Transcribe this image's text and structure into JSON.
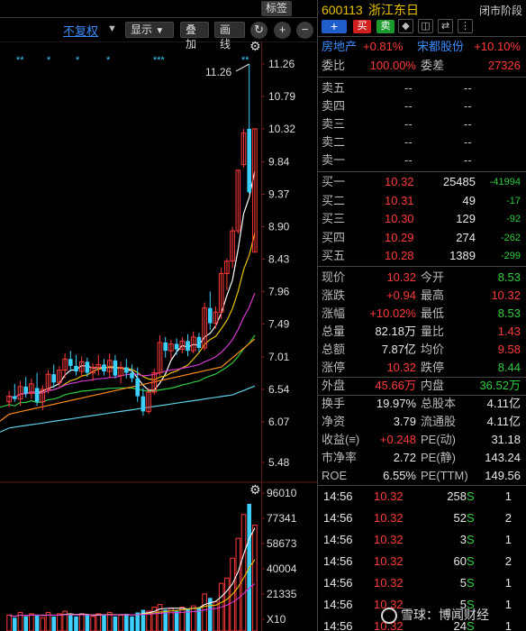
{
  "toolbar": {
    "label_button": "标签",
    "adjust_mode": "不复权",
    "display_label": "显示",
    "overlay_label": "叠加",
    "draw_label": "画线",
    "refresh_icon": "↻",
    "zoom_in_icon": "+",
    "zoom_out_icon": "−"
  },
  "chart_data": {
    "type": "candlestick",
    "main_axis_ticks": [
      "11.26",
      "10.79",
      "10.32",
      "9.84",
      "9.37",
      "8.90",
      "8.43",
      "7.96",
      "7.49",
      "7.01",
      "6.54",
      "6.07",
      "5.48"
    ],
    "ylim": [
      5.48,
      11.26
    ],
    "high_annotation": "11.26",
    "volume_axis_ticks": [
      "96010",
      "77341",
      "58673",
      "40004",
      "21335",
      "X10"
    ],
    "volume_ylim": [
      0,
      96010
    ],
    "markers": [
      "**",
      "*",
      "*",
      "*",
      "***",
      "**"
    ],
    "colors": {
      "up": "#ff3a3a",
      "up_hollow": "#ff3a3a",
      "down": "#3bd0ff",
      "ma5": "#ffffff",
      "ma10": "#e8c200",
      "ma20": "#d43ad4",
      "ma30": "#2ecc40",
      "ma60": "#ff8c1a",
      "ma120": "#5bd0e8"
    },
    "candles": [
      {
        "o": 6.36,
        "h": 6.52,
        "l": 6.28,
        "c": 6.44
      },
      {
        "o": 6.44,
        "h": 6.62,
        "l": 6.36,
        "c": 6.4
      },
      {
        "o": 6.4,
        "h": 6.66,
        "l": 6.3,
        "c": 6.58
      },
      {
        "o": 6.58,
        "h": 6.72,
        "l": 6.42,
        "c": 6.48
      },
      {
        "o": 6.48,
        "h": 6.7,
        "l": 6.4,
        "c": 6.62
      },
      {
        "o": 6.56,
        "h": 6.78,
        "l": 6.3,
        "c": 6.36
      },
      {
        "o": 6.36,
        "h": 6.6,
        "l": 6.24,
        "c": 6.54
      },
      {
        "o": 6.54,
        "h": 6.82,
        "l": 6.48,
        "c": 6.76
      },
      {
        "o": 6.76,
        "h": 6.9,
        "l": 6.56,
        "c": 6.64
      },
      {
        "o": 6.64,
        "h": 6.88,
        "l": 6.58,
        "c": 6.82
      },
      {
        "o": 6.82,
        "h": 7.06,
        "l": 6.7,
        "c": 6.98
      },
      {
        "o": 6.98,
        "h": 7.1,
        "l": 6.8,
        "c": 6.88
      },
      {
        "o": 6.88,
        "h": 7.04,
        "l": 6.74,
        "c": 6.8
      },
      {
        "o": 6.8,
        "h": 7.02,
        "l": 6.72,
        "c": 6.94
      },
      {
        "o": 6.94,
        "h": 7.0,
        "l": 6.72,
        "c": 6.78
      },
      {
        "o": 6.78,
        "h": 6.92,
        "l": 6.66,
        "c": 6.86
      },
      {
        "o": 6.86,
        "h": 7.04,
        "l": 6.74,
        "c": 6.9
      },
      {
        "o": 6.9,
        "h": 6.98,
        "l": 6.74,
        "c": 6.8
      },
      {
        "o": 6.8,
        "h": 7.06,
        "l": 6.7,
        "c": 6.96
      },
      {
        "o": 6.96,
        "h": 7.04,
        "l": 6.7,
        "c": 6.74
      },
      {
        "o": 6.74,
        "h": 6.94,
        "l": 6.62,
        "c": 6.86
      },
      {
        "o": 6.86,
        "h": 6.98,
        "l": 6.7,
        "c": 6.78
      },
      {
        "o": 6.78,
        "h": 6.9,
        "l": 6.64,
        "c": 6.7
      },
      {
        "o": 6.7,
        "h": 6.86,
        "l": 6.36,
        "c": 6.44
      },
      {
        "o": 6.44,
        "h": 6.56,
        "l": 6.16,
        "c": 6.22
      },
      {
        "o": 6.22,
        "h": 6.56,
        "l": 6.18,
        "c": 6.5
      },
      {
        "o": 6.5,
        "h": 6.84,
        "l": 6.46,
        "c": 6.78
      },
      {
        "o": 6.78,
        "h": 7.32,
        "l": 6.74,
        "c": 7.22
      },
      {
        "o": 7.22,
        "h": 7.3,
        "l": 7.0,
        "c": 7.1
      },
      {
        "o": 7.1,
        "h": 7.26,
        "l": 6.98,
        "c": 7.2
      },
      {
        "o": 7.2,
        "h": 7.28,
        "l": 7.04,
        "c": 7.12
      },
      {
        "o": 7.12,
        "h": 7.3,
        "l": 7.06,
        "c": 7.24
      },
      {
        "o": 7.24,
        "h": 7.34,
        "l": 7.02,
        "c": 7.1
      },
      {
        "o": 7.1,
        "h": 7.38,
        "l": 7.06,
        "c": 7.3
      },
      {
        "o": 7.3,
        "h": 7.36,
        "l": 7.08,
        "c": 7.14
      },
      {
        "o": 7.14,
        "h": 7.8,
        "l": 7.1,
        "c": 7.72
      },
      {
        "o": 7.72,
        "h": 7.96,
        "l": 7.4,
        "c": 7.5
      },
      {
        "o": 7.5,
        "h": 7.74,
        "l": 7.42,
        "c": 7.66
      },
      {
        "o": 7.66,
        "h": 8.3,
        "l": 7.56,
        "c": 8.22
      },
      {
        "o": 8.22,
        "h": 8.44,
        "l": 7.98,
        "c": 8.4
      },
      {
        "o": 8.4,
        "h": 8.9,
        "l": 8.3,
        "c": 8.84
      },
      {
        "o": 8.84,
        "h": 9.72,
        "l": 8.8,
        "c": 9.72
      },
      {
        "o": 9.8,
        "h": 10.32,
        "l": 9.76,
        "c": 10.26
      },
      {
        "o": 10.32,
        "h": 11.26,
        "l": 9.38,
        "c": 9.4
      },
      {
        "o": 8.53,
        "h": 10.32,
        "l": 8.53,
        "c": 10.32
      }
    ],
    "volumes": [
      12,
      10,
      14,
      11,
      13,
      12,
      10,
      14,
      11,
      13,
      15,
      12,
      11,
      13,
      12,
      11,
      13,
      12,
      14,
      11,
      12,
      13,
      11,
      14,
      16,
      15,
      18,
      20,
      16,
      17,
      15,
      18,
      17,
      19,
      18,
      28,
      25,
      22,
      36,
      40,
      55,
      70,
      88,
      96,
      80
    ]
  },
  "panel": {
    "code": "600113",
    "name": "浙江东日",
    "status": "闭市阶段",
    "add_label": "+",
    "buy_label": "买",
    "sell_label": "卖",
    "sector_name": "房地产",
    "sector_change": "+0.81%",
    "related_name": "宋都股份",
    "related_change": "+10.10%",
    "wei_bi_label": "委比",
    "wei_bi": "100.00%",
    "wei_cha_label": "委差",
    "wei_cha": "27326",
    "asks": [
      {
        "label": "卖五",
        "price": "--",
        "vol": "--"
      },
      {
        "label": "卖四",
        "price": "--",
        "vol": "--"
      },
      {
        "label": "卖三",
        "price": "--",
        "vol": "--"
      },
      {
        "label": "卖二",
        "price": "--",
        "vol": "--"
      },
      {
        "label": "卖一",
        "price": "--",
        "vol": "--"
      }
    ],
    "bids": [
      {
        "label": "买一",
        "price": "10.32",
        "vol": "25485",
        "chg": "-41994"
      },
      {
        "label": "买二",
        "price": "10.31",
        "vol": "49",
        "chg": "-17"
      },
      {
        "label": "买三",
        "price": "10.30",
        "vol": "129",
        "chg": "-92"
      },
      {
        "label": "买四",
        "price": "10.29",
        "vol": "274",
        "chg": "-262"
      },
      {
        "label": "买五",
        "price": "10.28",
        "vol": "1389",
        "chg": "-299"
      }
    ],
    "stats": [
      {
        "l1": "现价",
        "v1": "10.32",
        "c1": "red",
        "l2": "今开",
        "v2": "8.53",
        "c2": "green"
      },
      {
        "l1": "涨跌",
        "v1": "+0.94",
        "c1": "red",
        "l2": "最高",
        "v2": "10.32",
        "c2": "red"
      },
      {
        "l1": "涨幅",
        "v1": "+10.02%",
        "c1": "red",
        "l2": "最低",
        "v2": "8.53",
        "c2": "green"
      },
      {
        "l1": "总量",
        "v1": "82.18万",
        "c1": "white",
        "l2": "量比",
        "v2": "1.43",
        "c2": "red"
      },
      {
        "l1": "总额",
        "v1": "7.87亿",
        "c1": "white",
        "l2": "均价",
        "v2": "9.58",
        "c2": "red"
      },
      {
        "l1": "涨停",
        "v1": "10.32",
        "c1": "red",
        "l2": "跌停",
        "v2": "8.44",
        "c2": "green"
      },
      {
        "l1": "外盘",
        "v1": "45.66万",
        "c1": "red",
        "l2": "内盘",
        "v2": "36.52万",
        "c2": "green"
      },
      {
        "l1": "换手",
        "v1": "19.97%",
        "c1": "white",
        "l2": "总股本",
        "v2": "4.11亿",
        "c2": "white"
      },
      {
        "l1": "净资",
        "v1": "3.79",
        "c1": "white",
        "l2": "流通股",
        "v2": "4.11亿",
        "c2": "white"
      },
      {
        "l1": "收益(≡)",
        "v1": "+0.248",
        "c1": "red",
        "l2": "PE(动)",
        "v2": "31.18",
        "c2": "white"
      },
      {
        "l1": "市净率",
        "v1": "2.72",
        "c1": "white",
        "l2": "PE(静)",
        "v2": "143.24",
        "c2": "white"
      },
      {
        "l1": "ROE",
        "v1": "6.55%",
        "c1": "white",
        "l2": "PE(TTM)",
        "v2": "149.56",
        "c2": "white"
      }
    ],
    "ticks": [
      {
        "time": "14:56",
        "price": "10.32",
        "vol": "258",
        "side": "S",
        "n": "1"
      },
      {
        "time": "14:56",
        "price": "10.32",
        "vol": "52",
        "side": "S",
        "n": "2"
      },
      {
        "time": "14:56",
        "price": "10.32",
        "vol": "3",
        "side": "S",
        "n": "1"
      },
      {
        "time": "14:56",
        "price": "10.32",
        "vol": "60",
        "side": "S",
        "n": "2"
      },
      {
        "time": "14:56",
        "price": "10.32",
        "vol": "5",
        "side": "S",
        "n": "1"
      },
      {
        "time": "14:56",
        "price": "10.32",
        "vol": "5",
        "side": "S",
        "n": "1"
      },
      {
        "time": "14:56",
        "price": "10.32",
        "vol": "24",
        "side": "S",
        "n": "1"
      }
    ],
    "watermark": "雪球：博闻财经"
  }
}
